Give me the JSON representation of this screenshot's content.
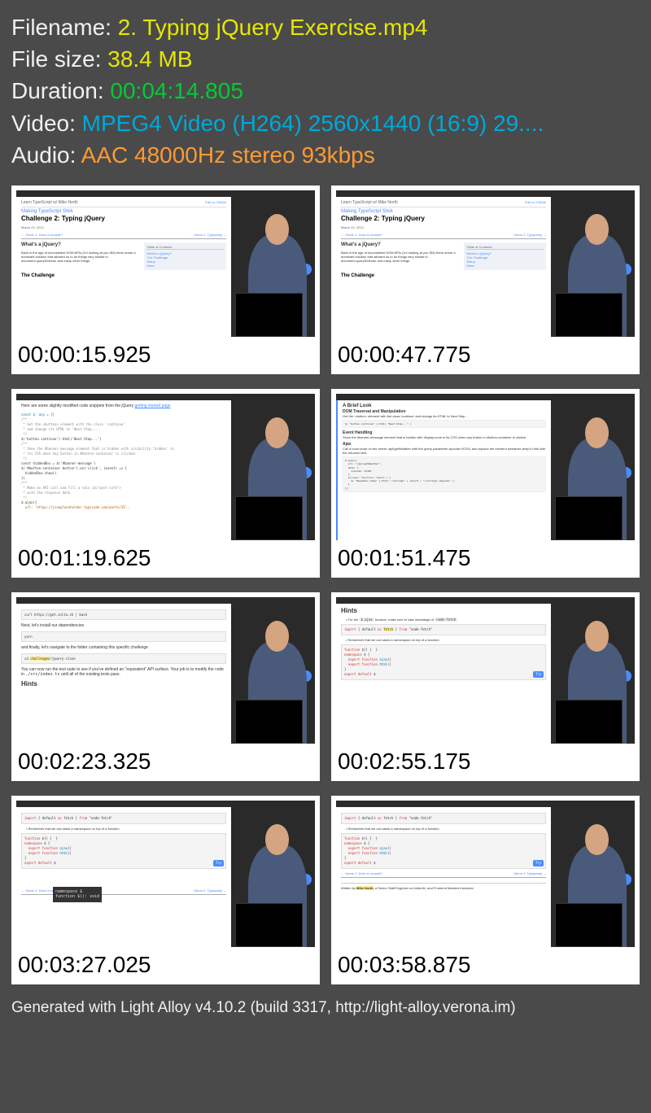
{
  "file_info": {
    "filename_label": "Filename: ",
    "filename_value": "2. Typing jQuery Exercise.mp4",
    "filesize_label": "File size: ",
    "filesize_value": "38.4 MB",
    "duration_label": "Duration: ",
    "duration_value": "00:04:14.805",
    "video_label": "Video: ",
    "video_value": "MPEG4 Video (H264) 2560x1440 (16:9) 29....",
    "audio_label": "Audio: ",
    "audio_value": "AAC 48000Hz stereo 93kbps"
  },
  "thumbnails": [
    {
      "timestamp": "00:00:15.925"
    },
    {
      "timestamp": "00:00:47.775"
    },
    {
      "timestamp": "00:01:19.625"
    },
    {
      "timestamp": "00:01:51.475"
    },
    {
      "timestamp": "00:02:23.325"
    },
    {
      "timestamp": "00:02:55.175"
    },
    {
      "timestamp": "00:03:27.025"
    },
    {
      "timestamp": "00:03:58.875"
    }
  ],
  "slide1": {
    "breadcrumb": "Learn TypeScript w/ Mike North",
    "series": "Making TypeScript Stick",
    "title": "Challenge 2: Typing jQuery",
    "github": "Edit on GitHub",
    "date": "March 22, 2022",
    "nav_prev": "← Game 1: Does it compile?",
    "nav_next": "Game 2: Typepardy →",
    "section_title": "What's a jQuery?",
    "body": "Back in the age of inconsistent DOM APIs (I'm looking at you IE6) there arose a dominant solution that allowed us to do things very similar to document.querySelector and many other things.",
    "toc_header": "Table of Contents",
    "toc_items": [
      "What's a jQuery?",
      "The Challenge",
      "Setup",
      "Hints"
    ],
    "bottom_heading": "The Challenge"
  },
  "slide3": {
    "intro": "Here are some slightly modified code snippets from the jQuery ",
    "intro_link": "getting started page",
    "lines": [
      "const $: any = {}",
      "/**",
      " * Get the <button> element with the class 'continue'",
      " * and change its HTML to 'Next Step...'",
      " */",
      "$('button.continue').html('Next Step...')",
      "",
      "/**",
      " * Show the #banner-message element that is hidden with visibility:'hidden' in",
      " * its CSS when any button in #button-container is clicked.",
      " */",
      "const hiddenBox = $('#banner-message')",
      "$('#button-container button').on('click', (event) => {",
      "  hiddenBox.show()",
      "})",
      "",
      "/**",
      " * Make an API call and fill a <div id=\"post-info\">",
      " * with the response data",
      " */",
      "$.ajax({",
      "  url: 'https://jsonplaceholder.typicode.com/posts/33',"
    ]
  },
  "slide4": {
    "brief_title": "A Brief Look",
    "dom_title": "DOM Traversal and Manipulation",
    "dom_text": "Get the <button> element with the class 'continue' and change its HTML to Next Step...",
    "dom_code": "$( \"button.continue\" ).html( \"Next Step...\" )",
    "event_title": "Event Handling",
    "event_text": "Show the #banner-message element that is hidden with display:none in its CSS when any button in #button-container is clicked.",
    "ajax_title": "Ajax",
    "ajax_text": "Call a local script on the server /api/getWeather with the query parameter zipcode=97201 and replace the element #weather-temp's html with the returned text.",
    "ajax_code": "$.ajax({\n  url: \"/api/getWeather\",\n  data: {\n    zipcode: 97201\n  },\n  success: function( result ) {\n    $( \"#weather-temp\" ).html( \"<strong>\" + result + \"</strong> degrees\" );\n  }\n});"
  },
  "slide5": {
    "cmd1": "curl https://get.volta.sh | bash",
    "text1": "Next, let's install our dependencies",
    "cmd2": "yarn",
    "text2": "and finally, let's navigate to the folder containing this specific challenge",
    "cmd3": "cd challenges/jquery-clone",
    "text3_a": "You can now run the test suite to see if you've defined an \"equivalent\" API surface. Your job is to modify the code in ",
    "text3_code": "./src/index.ts",
    "text3_b": " until all of the existing tests pass.",
    "hints_label": "Hints"
  },
  "slide6": {
    "title": "Hints",
    "bullet1_a": "For the ",
    "bullet1_code1": "$.ajax",
    "bullet1_b": " function, make sure to take advantage of ",
    "bullet1_code2": "node-fetch",
    "import_line": "import { default as fetch } from \"node-fetch\"",
    "bullet2": "Remember that we can stack a namespace on top of a function",
    "code2": "function $() {  }\nnamespace $ {\n  export function ajax()\n  export function html()\n}\nexport default $",
    "copy_label": "Try"
  },
  "slide7": {
    "import_line": "import { default as fetch } from \"node-fetch\"",
    "bullet": "Remember that we can stack a namespace on top of a function",
    "code": "function $() {  }\nnamespace $ {\n  export function ajax()\n  export function html()\n}\nexport default $",
    "tooltip_line1": "namespace $",
    "tooltip_line2": "function $(): void",
    "nav_prev": "← Game 1: Does it compile?",
    "nav_next": "Game 2: Typepardy →",
    "copy_label": "Try"
  },
  "slide8": {
    "import_line": "import { default as fetch } from \"node-fetch\"",
    "bullet": "Remember that we can stack a namespace on top of a function",
    "code": "function $() {  }\nnamespace $ {\n  export function ajax()\n  export function html()\n}\nexport default $",
    "nav_prev": "← Game 1: Does it compile?",
    "nav_next": "Game 2: Typepardy →",
    "author_prefix": "Written by ",
    "author": "Mike North",
    "author_suffix": ", a Senior Staff Engineer at LinkedIn, and Frontend Masters instructor.",
    "copy_label": "Try"
  },
  "footer": "Generated with Light Alloy v4.10.2 (build 3317, http://light-alloy.verona.im)"
}
